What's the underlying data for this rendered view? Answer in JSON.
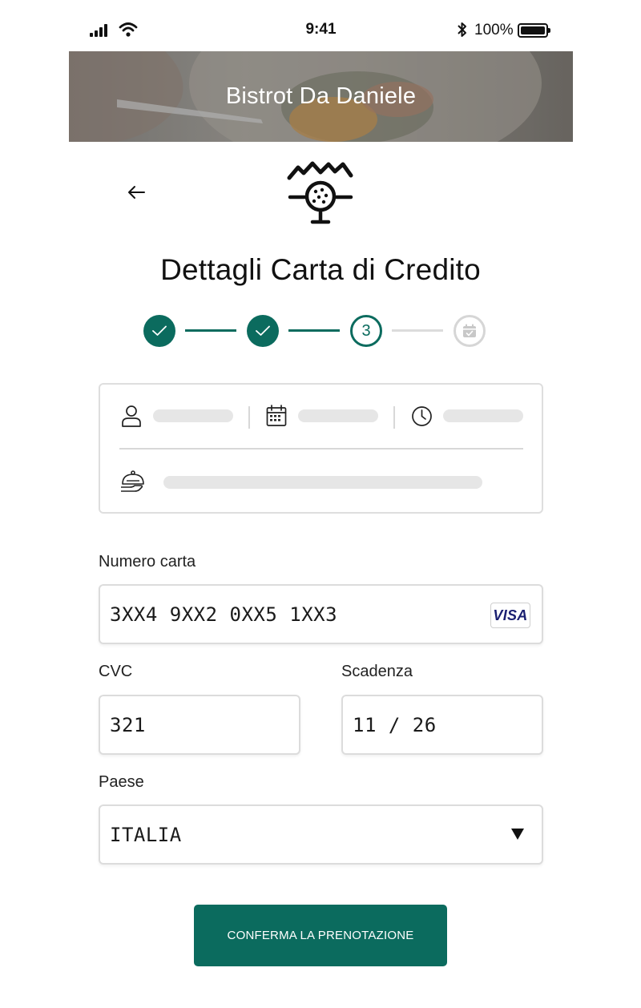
{
  "status_bar": {
    "time": "9:41",
    "battery_percent": "100%",
    "icons": [
      "signal-icon",
      "wifi-icon",
      "bluetooth-icon",
      "battery-icon"
    ]
  },
  "hero": {
    "restaurant_name": "Bistrot Da Daniele"
  },
  "header": {
    "back_icon": "arrow-left-icon",
    "logo_icon": "restaurant-logo-icon"
  },
  "page": {
    "title": "Dettagli Carta di Credito"
  },
  "stepper": {
    "steps": [
      {
        "state": "done",
        "icon": "check-icon"
      },
      {
        "state": "done",
        "icon": "check-icon"
      },
      {
        "state": "current",
        "label": "3"
      },
      {
        "state": "todo",
        "icon": "calendar-check-icon"
      }
    ],
    "current_step": 3,
    "total_steps": 4
  },
  "summary": {
    "icons": [
      "user-icon",
      "calendar-icon",
      "clock-icon",
      "cloche-icon"
    ]
  },
  "form": {
    "card_number": {
      "label": "Numero carta",
      "value": "3XX4 9XX2 0XX5 1XX3",
      "brand": "VISA"
    },
    "cvc": {
      "label": "CVC",
      "value": "321"
    },
    "expiry": {
      "label": "Scadenza",
      "value": "11 / 26"
    },
    "country": {
      "label": "Paese",
      "value": "ITALIA"
    }
  },
  "confirm_button": {
    "label": "CONFERMA LA PRENOTAZIONE"
  },
  "colors": {
    "accent": "#0b6b5e",
    "inactive": "#dcdcdc",
    "placeholder": "#e6e6e6"
  }
}
